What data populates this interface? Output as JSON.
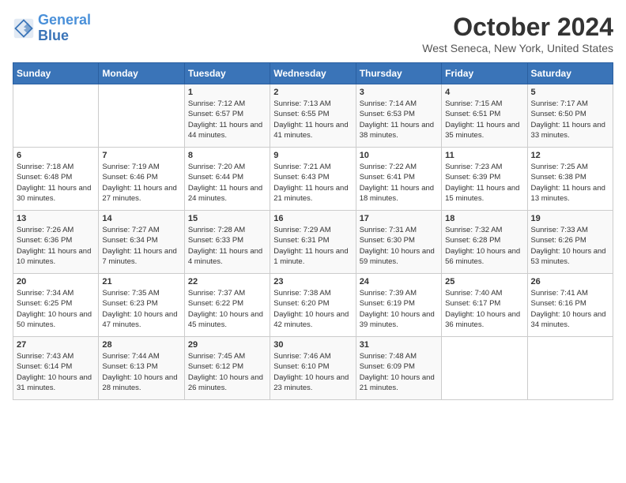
{
  "logo": {
    "line1": "General",
    "line2": "Blue"
  },
  "title": "October 2024",
  "location": "West Seneca, New York, United States",
  "headers": [
    "Sunday",
    "Monday",
    "Tuesday",
    "Wednesday",
    "Thursday",
    "Friday",
    "Saturday"
  ],
  "weeks": [
    [
      {
        "day": "",
        "info": ""
      },
      {
        "day": "",
        "info": ""
      },
      {
        "day": "1",
        "info": "Sunrise: 7:12 AM\nSunset: 6:57 PM\nDaylight: 11 hours and 44 minutes."
      },
      {
        "day": "2",
        "info": "Sunrise: 7:13 AM\nSunset: 6:55 PM\nDaylight: 11 hours and 41 minutes."
      },
      {
        "day": "3",
        "info": "Sunrise: 7:14 AM\nSunset: 6:53 PM\nDaylight: 11 hours and 38 minutes."
      },
      {
        "day": "4",
        "info": "Sunrise: 7:15 AM\nSunset: 6:51 PM\nDaylight: 11 hours and 35 minutes."
      },
      {
        "day": "5",
        "info": "Sunrise: 7:17 AM\nSunset: 6:50 PM\nDaylight: 11 hours and 33 minutes."
      }
    ],
    [
      {
        "day": "6",
        "info": "Sunrise: 7:18 AM\nSunset: 6:48 PM\nDaylight: 11 hours and 30 minutes."
      },
      {
        "day": "7",
        "info": "Sunrise: 7:19 AM\nSunset: 6:46 PM\nDaylight: 11 hours and 27 minutes."
      },
      {
        "day": "8",
        "info": "Sunrise: 7:20 AM\nSunset: 6:44 PM\nDaylight: 11 hours and 24 minutes."
      },
      {
        "day": "9",
        "info": "Sunrise: 7:21 AM\nSunset: 6:43 PM\nDaylight: 11 hours and 21 minutes."
      },
      {
        "day": "10",
        "info": "Sunrise: 7:22 AM\nSunset: 6:41 PM\nDaylight: 11 hours and 18 minutes."
      },
      {
        "day": "11",
        "info": "Sunrise: 7:23 AM\nSunset: 6:39 PM\nDaylight: 11 hours and 15 minutes."
      },
      {
        "day": "12",
        "info": "Sunrise: 7:25 AM\nSunset: 6:38 PM\nDaylight: 11 hours and 13 minutes."
      }
    ],
    [
      {
        "day": "13",
        "info": "Sunrise: 7:26 AM\nSunset: 6:36 PM\nDaylight: 11 hours and 10 minutes."
      },
      {
        "day": "14",
        "info": "Sunrise: 7:27 AM\nSunset: 6:34 PM\nDaylight: 11 hours and 7 minutes."
      },
      {
        "day": "15",
        "info": "Sunrise: 7:28 AM\nSunset: 6:33 PM\nDaylight: 11 hours and 4 minutes."
      },
      {
        "day": "16",
        "info": "Sunrise: 7:29 AM\nSunset: 6:31 PM\nDaylight: 11 hours and 1 minute."
      },
      {
        "day": "17",
        "info": "Sunrise: 7:31 AM\nSunset: 6:30 PM\nDaylight: 10 hours and 59 minutes."
      },
      {
        "day": "18",
        "info": "Sunrise: 7:32 AM\nSunset: 6:28 PM\nDaylight: 10 hours and 56 minutes."
      },
      {
        "day": "19",
        "info": "Sunrise: 7:33 AM\nSunset: 6:26 PM\nDaylight: 10 hours and 53 minutes."
      }
    ],
    [
      {
        "day": "20",
        "info": "Sunrise: 7:34 AM\nSunset: 6:25 PM\nDaylight: 10 hours and 50 minutes."
      },
      {
        "day": "21",
        "info": "Sunrise: 7:35 AM\nSunset: 6:23 PM\nDaylight: 10 hours and 47 minutes."
      },
      {
        "day": "22",
        "info": "Sunrise: 7:37 AM\nSunset: 6:22 PM\nDaylight: 10 hours and 45 minutes."
      },
      {
        "day": "23",
        "info": "Sunrise: 7:38 AM\nSunset: 6:20 PM\nDaylight: 10 hours and 42 minutes."
      },
      {
        "day": "24",
        "info": "Sunrise: 7:39 AM\nSunset: 6:19 PM\nDaylight: 10 hours and 39 minutes."
      },
      {
        "day": "25",
        "info": "Sunrise: 7:40 AM\nSunset: 6:17 PM\nDaylight: 10 hours and 36 minutes."
      },
      {
        "day": "26",
        "info": "Sunrise: 7:41 AM\nSunset: 6:16 PM\nDaylight: 10 hours and 34 minutes."
      }
    ],
    [
      {
        "day": "27",
        "info": "Sunrise: 7:43 AM\nSunset: 6:14 PM\nDaylight: 10 hours and 31 minutes."
      },
      {
        "day": "28",
        "info": "Sunrise: 7:44 AM\nSunset: 6:13 PM\nDaylight: 10 hours and 28 minutes."
      },
      {
        "day": "29",
        "info": "Sunrise: 7:45 AM\nSunset: 6:12 PM\nDaylight: 10 hours and 26 minutes."
      },
      {
        "day": "30",
        "info": "Sunrise: 7:46 AM\nSunset: 6:10 PM\nDaylight: 10 hours and 23 minutes."
      },
      {
        "day": "31",
        "info": "Sunrise: 7:48 AM\nSunset: 6:09 PM\nDaylight: 10 hours and 21 minutes."
      },
      {
        "day": "",
        "info": ""
      },
      {
        "day": "",
        "info": ""
      }
    ]
  ]
}
